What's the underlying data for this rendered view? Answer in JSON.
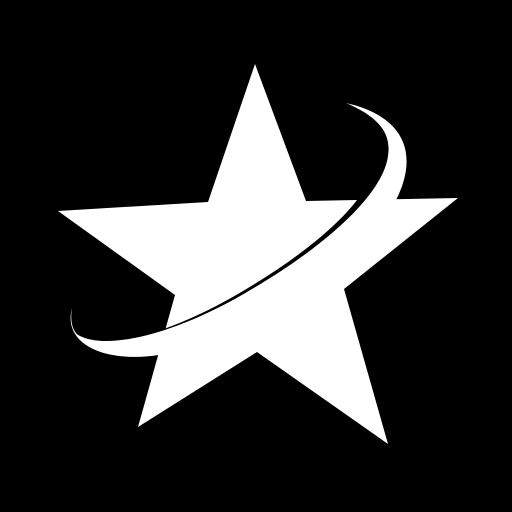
{
  "logo": {
    "icon": "star-with-orbit-swoosh-icon",
    "background_color": "#000000",
    "foreground_color": "#ffffff"
  }
}
